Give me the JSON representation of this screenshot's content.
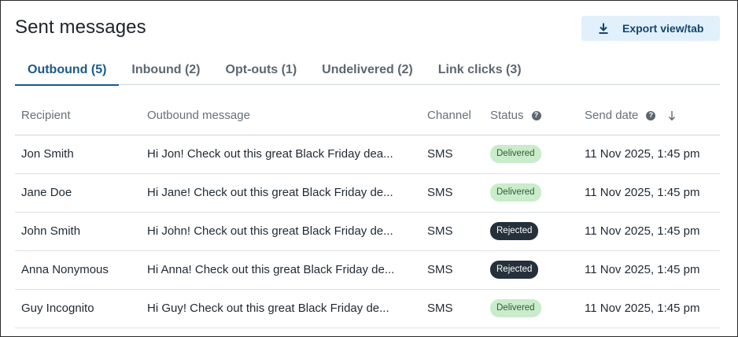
{
  "header": {
    "title": "Sent messages",
    "export_label": "Export view/tab"
  },
  "tabs": [
    {
      "label": "Outbound (5)",
      "active": true
    },
    {
      "label": "Inbound (2)",
      "active": false
    },
    {
      "label": "Opt-outs (1)",
      "active": false
    },
    {
      "label": "Undelivered (2)",
      "active": false
    },
    {
      "label": "Link clicks (3)",
      "active": false
    }
  ],
  "table": {
    "columns": {
      "recipient": "Recipient",
      "message": "Outbound message",
      "channel": "Channel",
      "status": "Status",
      "send_date": "Send date"
    },
    "rows": [
      {
        "recipient": "Jon Smith",
        "message": "Hi Jon! Check out this great Black Friday dea...",
        "channel": "SMS",
        "status": "Delivered",
        "send_date": "11 Nov 2025, 1:45 pm"
      },
      {
        "recipient": "Jane Doe",
        "message": "Hi Jane! Check out this great Black Friday de...",
        "channel": "SMS",
        "status": "Delivered",
        "send_date": "11 Nov 2025, 1:45 pm"
      },
      {
        "recipient": "John Smith",
        "message": "Hi John! Check out this great Black Friday de...",
        "channel": "SMS",
        "status": "Rejected",
        "send_date": "11 Nov 2025, 1:45 pm"
      },
      {
        "recipient": "Anna Nonymous",
        "message": "Hi Anna! Check out this great Black Friday de...",
        "channel": "SMS",
        "status": "Rejected",
        "send_date": "11 Nov 2025, 1:45 pm"
      },
      {
        "recipient": "Guy Incognito",
        "message": "Hi Guy! Check out this great Black Friday de...",
        "channel": "SMS",
        "status": "Delivered",
        "send_date": "11 Nov 2025, 1:45 pm"
      }
    ]
  },
  "icons": {
    "export": "download-icon",
    "help": "help-circle-icon",
    "sort": "arrow-down-icon"
  },
  "colors": {
    "accent": "#1a5a8a",
    "export_bg": "#e1f0fa",
    "delivered_bg": "#c9ecca",
    "rejected_bg": "#25303b"
  }
}
